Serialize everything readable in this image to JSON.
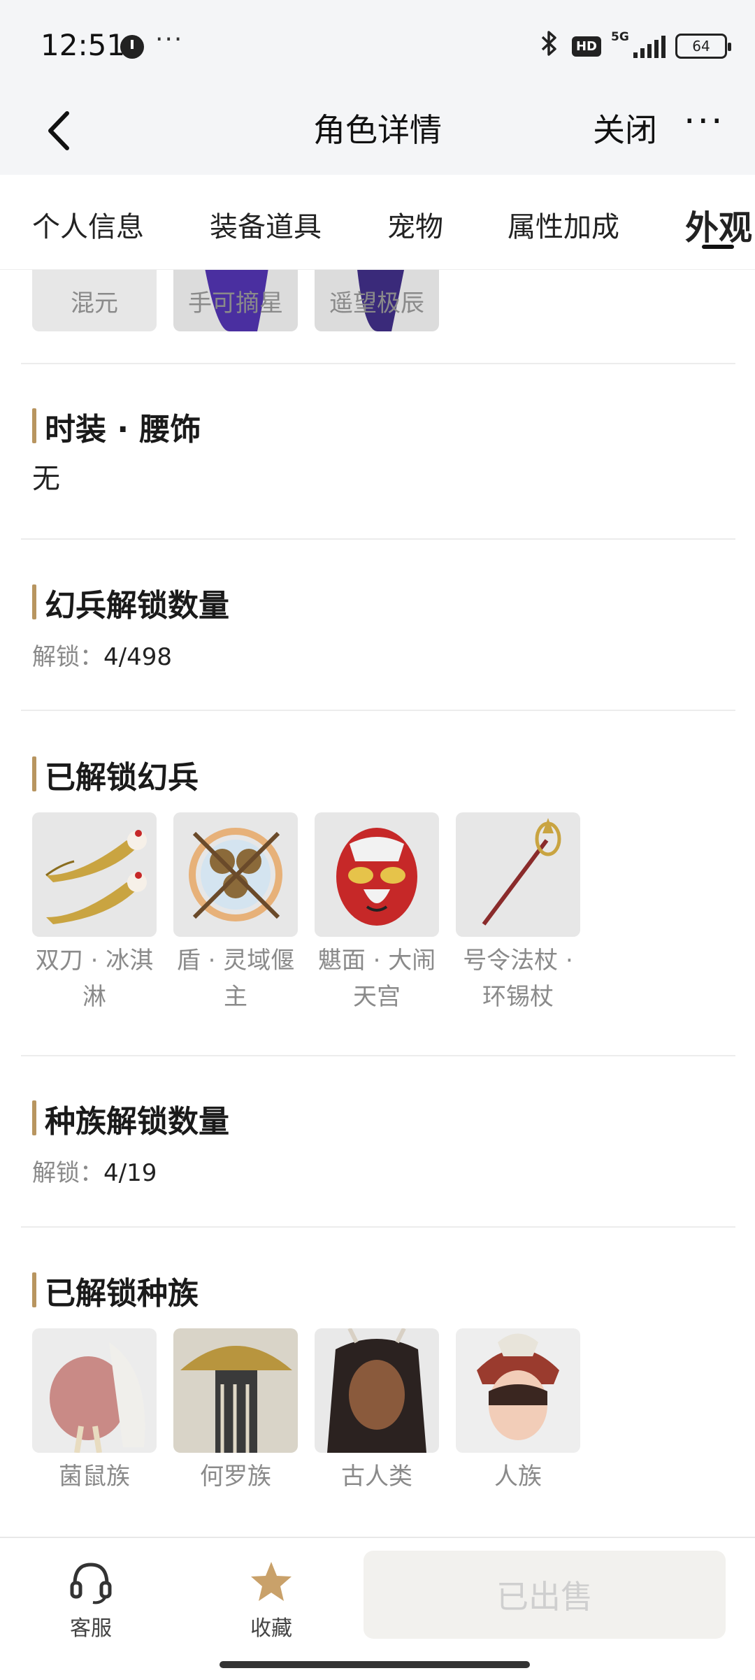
{
  "status_bar": {
    "time": "12:51",
    "more": "···",
    "network": "5G",
    "hd": "HD",
    "battery": "64"
  },
  "nav": {
    "title": "角色详情",
    "close_label": "关闭",
    "more": "···"
  },
  "tabs": [
    {
      "label": "个人信息",
      "active": false
    },
    {
      "label": "装备道具",
      "active": false
    },
    {
      "label": "宠物",
      "active": false
    },
    {
      "label": "属性加成",
      "active": false
    },
    {
      "label": "外观",
      "active": true
    }
  ],
  "top_items": [
    {
      "name": "混元"
    },
    {
      "name": "手可摘星"
    },
    {
      "name": "遥望极辰"
    }
  ],
  "waist_section": {
    "title": "时装 · 腰饰",
    "value": "无"
  },
  "weapon_count_section": {
    "title": "幻兵解锁数量",
    "unlock_key": "解锁：",
    "unlock_value": "4/498"
  },
  "weapons_section": {
    "title": "已解锁幻兵",
    "items": [
      {
        "name_line1": "双刀 · 冰淇",
        "name_line2": "淋",
        "icon": "twin-blades-icecream-icon"
      },
      {
        "name_line1": "盾 · 灵域偃",
        "name_line2": "主",
        "icon": "shield-spirit-icon"
      },
      {
        "name_line1": "魌面 · 大闹",
        "name_line2": "天宫",
        "icon": "monkey-mask-icon"
      },
      {
        "name_line1": "号令法杖 ·",
        "name_line2": "环锡杖",
        "icon": "staff-icon"
      }
    ]
  },
  "race_count_section": {
    "title": "种族解锁数量",
    "unlock_key": "解锁：",
    "unlock_value": "4/19"
  },
  "races_section": {
    "title": "已解锁种族",
    "items": [
      {
        "name": "菌鼠族",
        "icon": "rat-race-portrait"
      },
      {
        "name": "何罗族",
        "icon": "straw-hat-race-portrait"
      },
      {
        "name": "古人类",
        "icon": "ancient-human-portrait"
      },
      {
        "name": "人族",
        "icon": "human-race-portrait"
      }
    ]
  },
  "bottom_bar": {
    "service_label": "客服",
    "favorite_label": "收藏",
    "sold_label": "已出售"
  },
  "colors": {
    "accent_bar": "#b89560",
    "background": "#f4f5f7",
    "muted_text": "#8a8a8a"
  }
}
